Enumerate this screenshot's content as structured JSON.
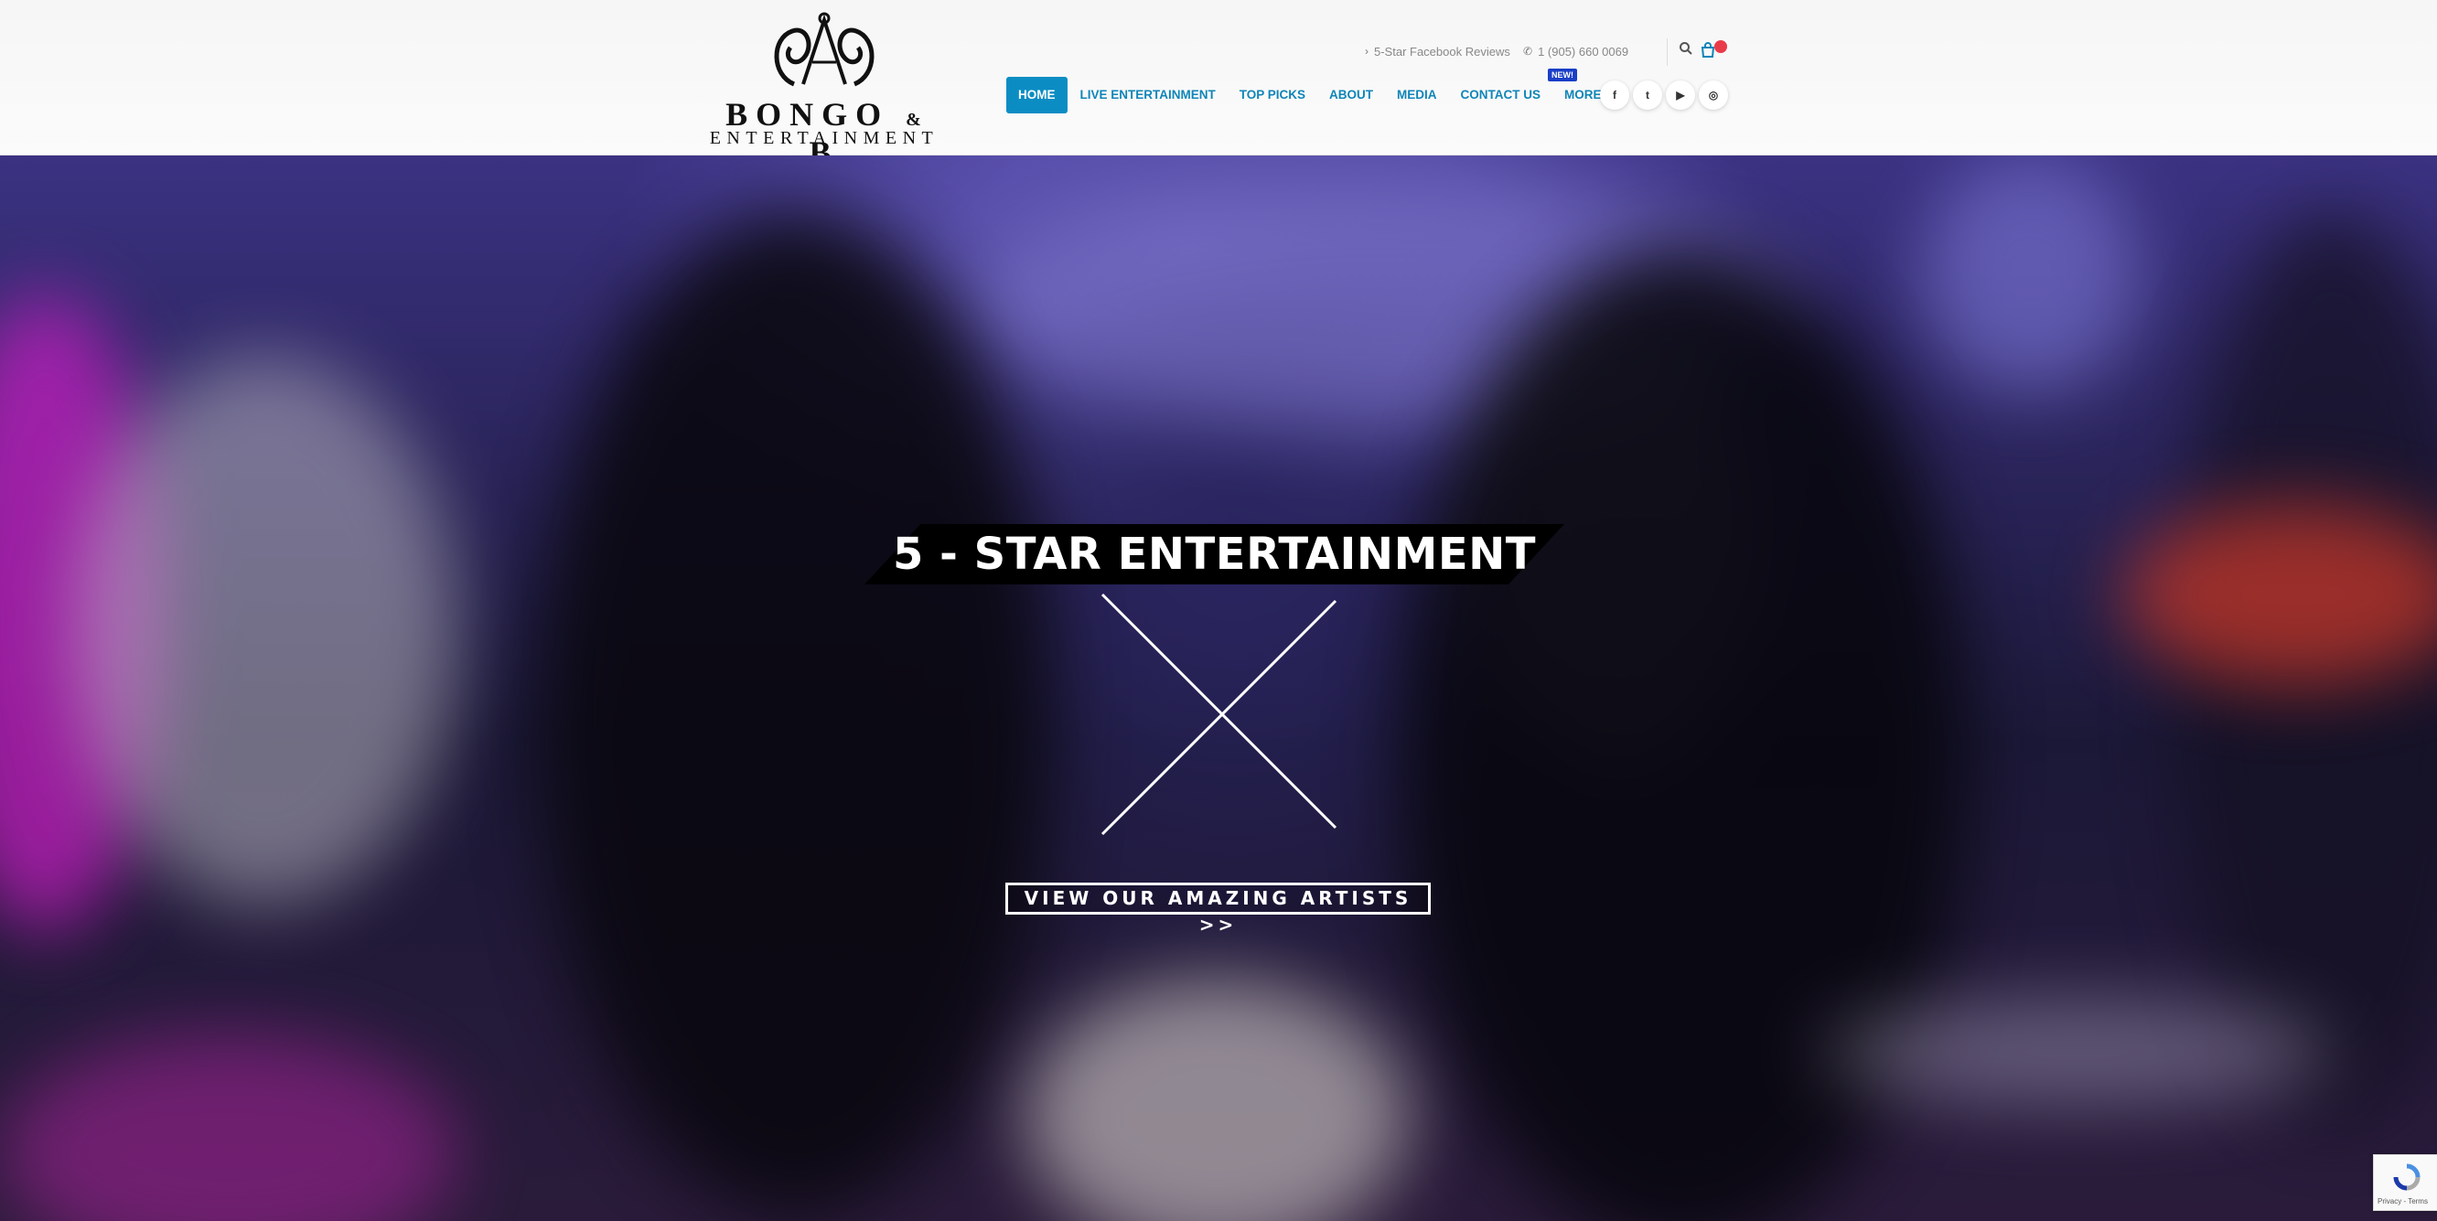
{
  "header": {
    "logo": {
      "main": "BONGO",
      "amp": "&",
      "main_b": "B",
      "sub": "ENTERTAINMENT"
    },
    "topbar": {
      "reviews_label": "5-Star Facebook Reviews",
      "phone": "1 (905) 660 0069",
      "search_icon": "search-icon",
      "cart_icon": "cart-icon"
    },
    "nav": {
      "items": [
        {
          "label": "HOME",
          "active": true
        },
        {
          "label": "LIVE ENTERTAINMENT"
        },
        {
          "label": "TOP PICKS"
        },
        {
          "label": "ABOUT"
        },
        {
          "label": "MEDIA"
        },
        {
          "label": "CONTACT US"
        },
        {
          "label": "MORE... ⌄"
        }
      ],
      "new_badge": "NEW!"
    },
    "socials": [
      {
        "icon": "facebook-icon",
        "glyph": "f"
      },
      {
        "icon": "twitter-icon",
        "glyph": "t"
      },
      {
        "icon": "youtube-icon",
        "glyph": "▶"
      },
      {
        "icon": "instagram-icon",
        "glyph": "◎"
      }
    ]
  },
  "hero": {
    "headline": "5 - STAR ENTERTAINMENT",
    "cta_label": "VIEW OUR AMAZING ARTISTS >>"
  },
  "recaptcha": {
    "text": "Privacy - Terms"
  },
  "colors": {
    "accent": "#0b8dc4",
    "nav_text": "#0f85b8",
    "badge": "#1a3ec7",
    "cart_badge": "#e93a4a"
  }
}
